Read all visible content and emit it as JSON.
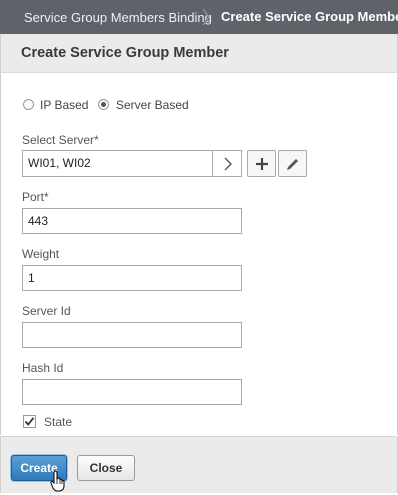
{
  "breadcrumb": {
    "parent": "Service Group Members Binding",
    "current": "Create Service Group Member"
  },
  "dialog": {
    "title": "Create Service Group Member"
  },
  "member_type": {
    "options": [
      {
        "label": "IP Based",
        "selected": false
      },
      {
        "label": "Server Based",
        "selected": true
      }
    ]
  },
  "fields": {
    "select_server": {
      "label": "Select Server*",
      "value": "WI01, WI02"
    },
    "port": {
      "label": "Port*",
      "value": "443"
    },
    "weight": {
      "label": "Weight",
      "value": "1"
    },
    "server_id": {
      "label": "Server Id",
      "value": ""
    },
    "hash_id": {
      "label": "Hash Id",
      "value": ""
    },
    "state": {
      "label": "State",
      "checked": true
    }
  },
  "buttons": {
    "create": "Create",
    "close": "Close"
  },
  "icons": {
    "breadcrumb_separator": "chevron-right-icon",
    "select_server_open": "chevron-right-icon",
    "add": "plus-icon",
    "edit": "pencil-icon",
    "cursor": "hand-pointer-icon"
  },
  "colors": {
    "breadcrumb_bar": "#5e6369",
    "panel_header": "#ebebeb",
    "primary_button": "#3a86c6"
  }
}
